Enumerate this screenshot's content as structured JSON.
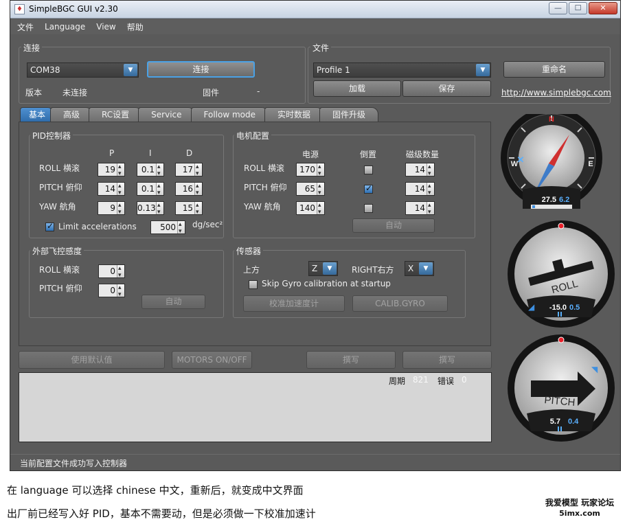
{
  "window": {
    "title": "SimpleBGC GUI v2.30"
  },
  "menu": [
    "文件",
    "Language",
    "View",
    "帮助"
  ],
  "connection": {
    "group_label": "连接",
    "port_value": "COM38",
    "connect_button": "连接",
    "version_label": "版本",
    "version_value": "未连接",
    "firmware_label": "固件",
    "firmware_value": "-"
  },
  "file": {
    "group_label": "文件",
    "profile_value": "Profile 1",
    "rename_button": "重命名",
    "load_button": "加载",
    "save_button": "保存",
    "link": "http://www.simplebgc.com"
  },
  "tabs": [
    "基本",
    "高级",
    "RC设置",
    "Service",
    "Follow mode",
    "实时数据",
    "固件升级"
  ],
  "active_tab": 0,
  "pid": {
    "group_label": "PID控制器",
    "headers": [
      "P",
      "I",
      "D"
    ],
    "rows": [
      {
        "label": "ROLL 横滚",
        "p": "19",
        "i": "0.1",
        "d": "17"
      },
      {
        "label": "PITCH 俯仰",
        "p": "14",
        "i": "0.1",
        "d": "16"
      },
      {
        "label": "YAW 航角",
        "p": "9",
        "i": "0.13",
        "d": "15"
      }
    ],
    "limit_label": "Limit accelerations",
    "limit_checked": true,
    "limit_value": "500",
    "limit_unit": "dg/sec²"
  },
  "motor": {
    "group_label": "电机配置",
    "headers": [
      "电源",
      "倒置",
      "磁级数量"
    ],
    "rows": [
      {
        "label": "ROLL 横滚",
        "power": "170",
        "invert": false,
        "poles": "14"
      },
      {
        "label": "PITCH 俯仰",
        "power": "65",
        "invert": true,
        "poles": "14"
      },
      {
        "label": "YAW 航角",
        "power": "140",
        "invert": false,
        "poles": "14"
      }
    ],
    "auto_button": "自动"
  },
  "ext": {
    "group_label": "外部飞控感度",
    "rows": [
      {
        "label": "ROLL 横滚",
        "value": "0"
      },
      {
        "label": "PITCH 俯仰",
        "value": "0"
      }
    ],
    "auto_button": "自动"
  },
  "sensor": {
    "group_label": "传感器",
    "top_label": "上方",
    "top_value": "Z",
    "right_label": "RIGHT右方",
    "right_value": "X",
    "skip_label": "Skip Gyro calibration at startup",
    "skip_checked": false,
    "calib_acc_button": "校准加速度计",
    "calib_gyro_button": "CALIB.GYRO"
  },
  "bottom_buttons": {
    "defaults": "使用默认值",
    "motors": "MOTORS ON/OFF",
    "write1": "撰写",
    "write2": "撰写"
  },
  "console": {
    "cycle_label": "周期",
    "cycle_value": "821",
    "error_label": "错误",
    "error_value": "0"
  },
  "status": "当前配置文件成功写入控制器",
  "gauges": {
    "compass": {
      "n": "N",
      "e": "E",
      "w": "W",
      "value": "27.5",
      "value2": "6.2"
    },
    "roll": {
      "label": "ROLL",
      "value": "-15.0",
      "value2": "0.5"
    },
    "pitch": {
      "label": "PITCH",
      "value": "5.7",
      "value2": "0.4"
    }
  },
  "doc": {
    "line1": "在 language  可以选择 chinese  中文，重新后，就变成中文界面",
    "line2": "出厂前已经写入好 PID，基本不需要动，但是必须做一下校准加速计",
    "watermark1": "我爱模型 玩家论坛",
    "watermark2": "5imx.com"
  },
  "colors": {
    "accent": "#3d8fe0",
    "panel": "#5a5a5a",
    "gauge_value": "#5ab0ff",
    "marker_red": "#e8202a"
  }
}
